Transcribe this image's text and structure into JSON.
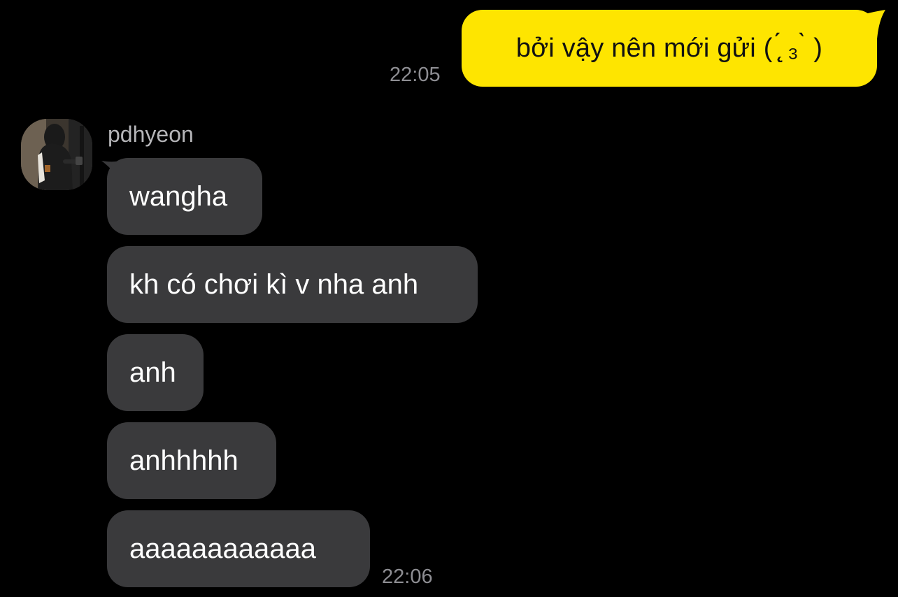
{
  "outgoing": {
    "text": "bởi vậy nên mới gửi ( ̨̨̨̨̨̨̨́ ₃ ̀ )",
    "time": "22:05"
  },
  "incoming": {
    "sender": "pdhyeon",
    "time": "22:06",
    "messages": [
      "wangha",
      "kh có chơi kì v nha anh",
      "anh",
      "anhhhhh",
      "aaaaaaaaaaaa"
    ]
  },
  "colors": {
    "background": "#000000",
    "outgoing_bubble": "#fee500",
    "incoming_bubble": "#3a3a3c",
    "timestamp": "#8e8e93"
  }
}
